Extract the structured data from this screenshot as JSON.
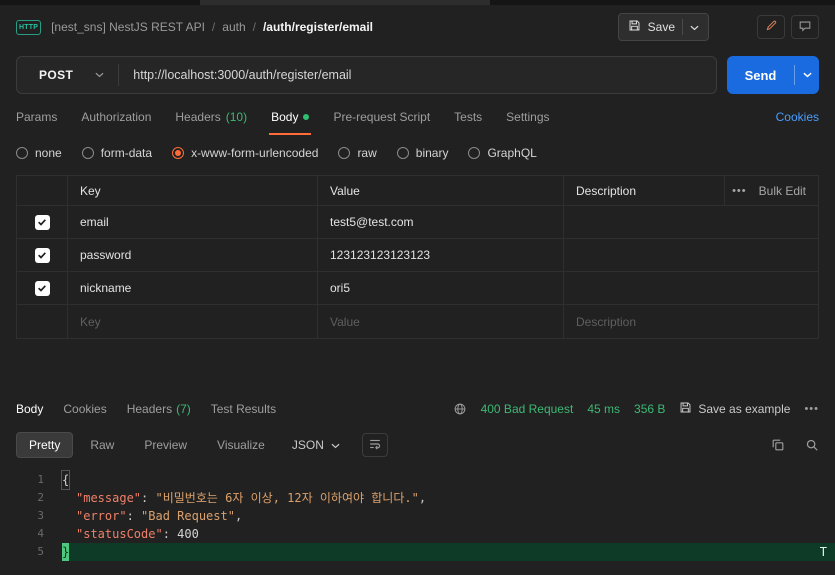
{
  "header": {
    "breadcrumb": {
      "collection": "[nest_sns] NestJS REST API",
      "separator": "/",
      "folder": "auth",
      "request_name": "/auth/register/email"
    },
    "save_button": "Save"
  },
  "request_bar": {
    "method": "POST",
    "url": "http://localhost:3000/auth/register/email",
    "send_button": "Send"
  },
  "request_tabs": {
    "params": "Params",
    "authorization": "Authorization",
    "headers": "Headers",
    "headers_count": "(10)",
    "body": "Body",
    "pre_request": "Pre-request Script",
    "tests": "Tests",
    "settings": "Settings",
    "cookies": "Cookies"
  },
  "body_type": {
    "none": "none",
    "form_data": "form-data",
    "urlencoded": "x-www-form-urlencoded",
    "raw": "raw",
    "binary": "binary",
    "graphql": "GraphQL",
    "selected": "x-www-form-urlencoded"
  },
  "form_table": {
    "col_key": "Key",
    "col_value": "Value",
    "col_description": "Description",
    "more": "•••",
    "bulk_edit": "Bulk Edit",
    "rows": [
      {
        "key": "email",
        "value": "test5@test.com",
        "description": "",
        "checked": true
      },
      {
        "key": "password",
        "value": "123123123123123",
        "description": "",
        "checked": true
      },
      {
        "key": "nickname",
        "value": "ori5",
        "description": "",
        "checked": true
      }
    ],
    "placeholder": {
      "key": "Key",
      "value": "Value",
      "description": "Description"
    }
  },
  "response": {
    "tab_body": "Body",
    "tab_cookies": "Cookies",
    "tab_headers": "Headers",
    "headers_count": "(7)",
    "tab_tests": "Test Results",
    "status": "400 Bad Request",
    "time": "45 ms",
    "size": "356 B",
    "save_as_example": "Save as example",
    "more": "•••",
    "views": {
      "pretty": "Pretty",
      "raw": "Raw",
      "preview": "Preview",
      "visualize": "Visualize"
    },
    "active_view": "Pretty",
    "format": "JSON"
  },
  "response_body": {
    "line_numbers": [
      "1",
      "2",
      "3",
      "4",
      "5"
    ],
    "open_brace": "{",
    "close_brace": "}",
    "entries": [
      {
        "key": "\"message\"",
        "sep": ": ",
        "value": "\"비밀번호는 6자 이상, 12자 이하여야 합니다.\"",
        "comma": ","
      },
      {
        "key": "\"error\"",
        "sep": ": ",
        "value": "\"Bad Request\"",
        "comma": ","
      },
      {
        "key": "\"statusCode\"",
        "sep": ": ",
        "value": "400",
        "comma": ""
      }
    ],
    "cursor_marker": "T"
  },
  "colors": {
    "accent_orange": "#ff6c37",
    "send_blue": "#1a6be0",
    "link_blue": "#4a9eff",
    "status_green": "#3db873",
    "json_key": "#ef8068",
    "json_string": "#dba16c",
    "selection_green": "#4ec77e"
  }
}
